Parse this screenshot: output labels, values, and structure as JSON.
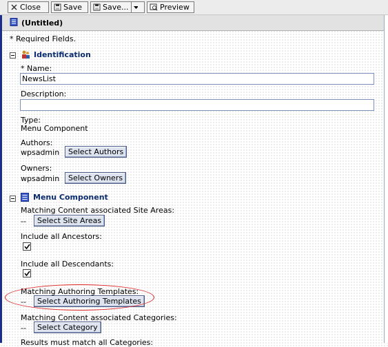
{
  "toolbar": {
    "close_label": "Close",
    "save_label": "Save",
    "save_as_label": "Save...",
    "preview_label": "Preview"
  },
  "document": {
    "title": "(Untitled)"
  },
  "required_note": "* Required Fields.",
  "identification": {
    "heading": "Identification",
    "name_label": "* Name:",
    "name_value": "NewsList",
    "description_label": "Description:",
    "description_value": "",
    "type_label": "Type:",
    "type_value": "Menu Component",
    "authors_label": "Authors:",
    "authors_value": "wpsadmin",
    "select_authors_label": "Select Authors",
    "owners_label": "Owners:",
    "owners_value": "wpsadmin",
    "select_owners_label": "Select Owners"
  },
  "menu_component": {
    "heading": "Menu Component",
    "site_areas_label": "Matching Content associated Site Areas:",
    "site_areas_value": "--",
    "select_site_areas_label": "Select Site Areas",
    "include_ancestors_label": "Include all Ancestors:",
    "include_ancestors_checked": true,
    "include_descendants_label": "Include all Descendants:",
    "include_descendants_checked": true,
    "authoring_templates_label": "Matching Authoring Templates:",
    "authoring_templates_value": "--",
    "select_authoring_templates_label": "Select Authoring Templates",
    "categories_label": "Matching Content associated Categories:",
    "categories_value": "--",
    "select_category_label": "Select Category",
    "results_match_label": "Results must match all Categories:"
  },
  "colors": {
    "frame": "#1c2e8c",
    "heading_text": "#0a2a6e",
    "highlight_ellipse": "#dd2222"
  }
}
